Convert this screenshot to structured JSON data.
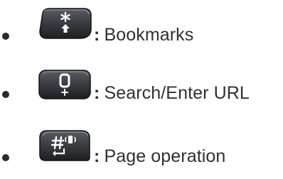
{
  "items": [
    {
      "key_icon": "star-key-icon",
      "separator": ":",
      "text": "Bookmarks"
    },
    {
      "key_icon": "zero-plus-key-icon",
      "separator": ":",
      "text": "Search/Enter URL"
    },
    {
      "key_icon": "pound-vibrate-key-icon",
      "separator": ":",
      "text": "Page operation"
    }
  ],
  "colors": {
    "text": "#303030",
    "bullet": "#2a2a2a",
    "key_body": "#3c3f44",
    "key_glyph": "#ffffff"
  }
}
